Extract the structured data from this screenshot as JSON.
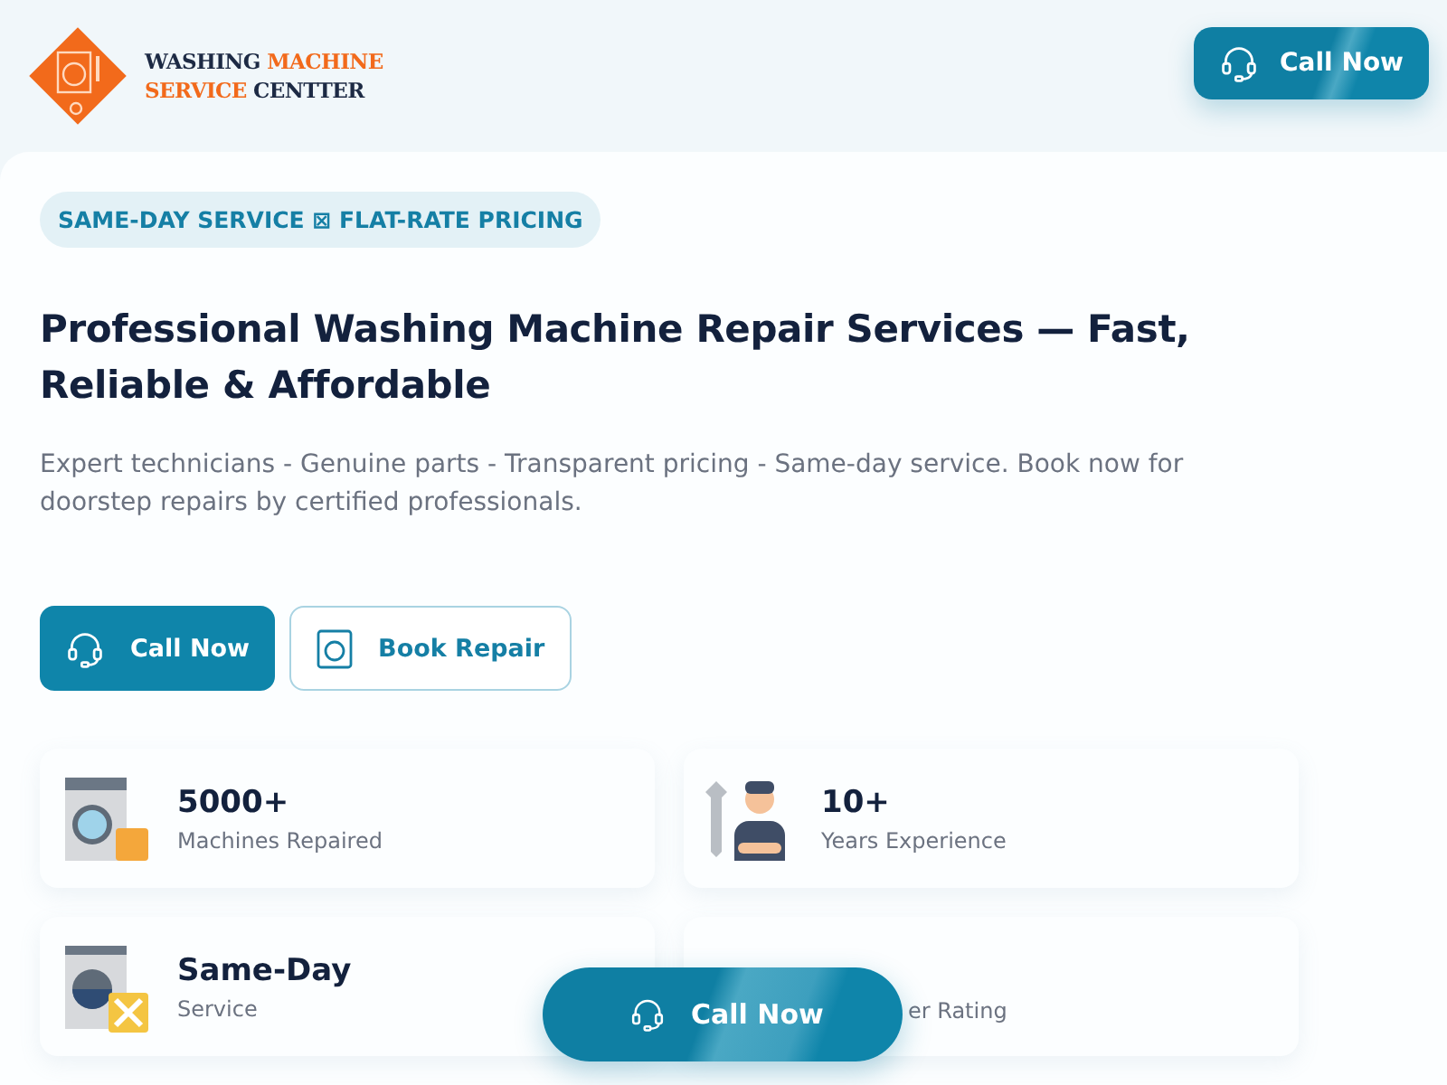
{
  "header": {
    "logo": {
      "line1_dark": "WASHING",
      "line1_accent": "MACHINE",
      "line2_accent": "SERVICE",
      "line2_dark": "CENTTER"
    },
    "call_button": "Call Now"
  },
  "hero": {
    "badge": "SAME-DAY SERVICE ⊠ FLAT-RATE PRICING",
    "title": "Professional Washing Machine Repair Services — Fast, Reliable & Affordable",
    "subtitle": "Expert technicians - Genuine parts - Transparent pricing - Same-day service. Book now for doorstep repairs by certified professionals.",
    "buttons": [
      {
        "kind": "primary",
        "label": "Call Now"
      },
      {
        "kind": "outline",
        "label": "Book Repair"
      }
    ]
  },
  "stats": [
    {
      "kind": "washer",
      "value": "5000+",
      "label": "Machines Repaired"
    },
    {
      "kind": "mechanic",
      "value": "10+",
      "label": "Years Experience"
    },
    {
      "kind": "washer-tools",
      "value": "Same-Day",
      "label": "Service"
    },
    {
      "kind": "covered",
      "label": "er Rating"
    }
  ],
  "floating_button": "Call Now"
}
